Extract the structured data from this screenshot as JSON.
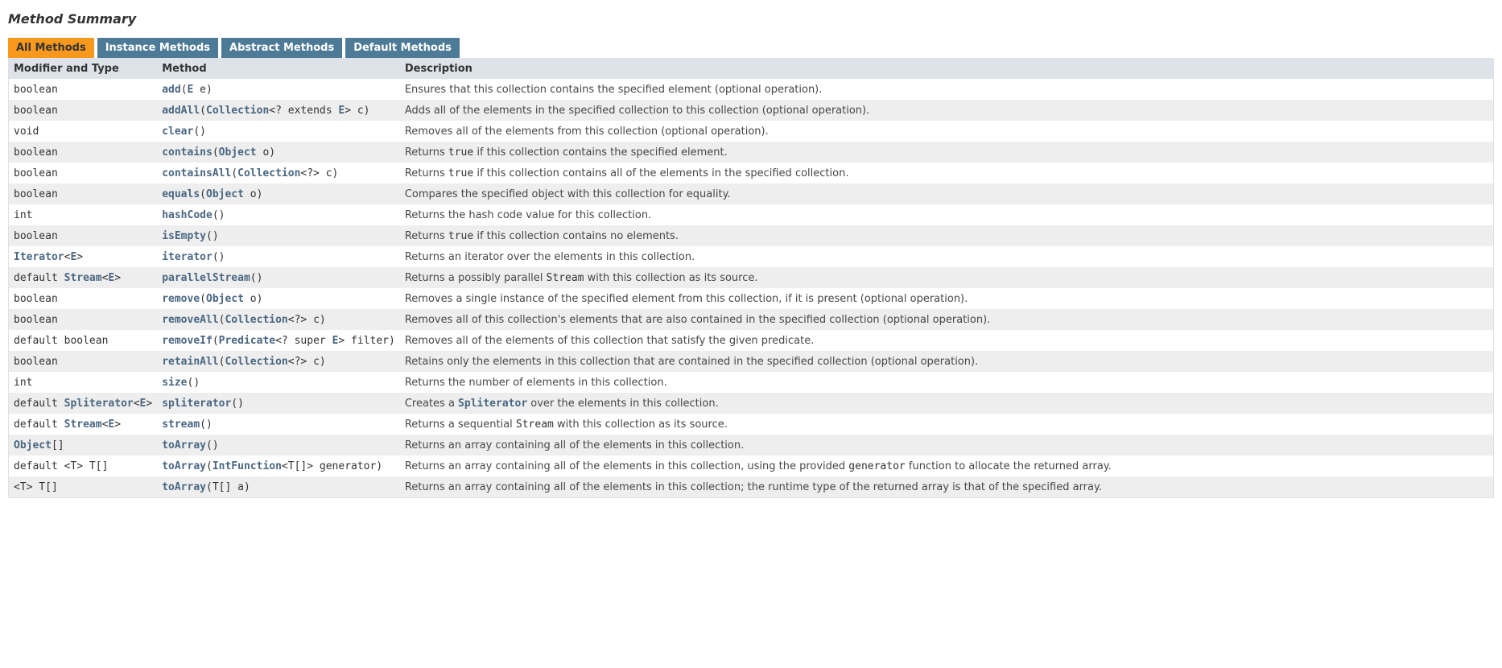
{
  "section_title": "Method Summary",
  "tabs": [
    {
      "label": "All Methods",
      "active": true
    },
    {
      "label": "Instance Methods",
      "active": false
    },
    {
      "label": "Abstract Methods",
      "active": false
    },
    {
      "label": "Default Methods",
      "active": false
    }
  ],
  "columns": {
    "modifier": "Modifier and Type",
    "method": "Method",
    "description": "Description"
  },
  "rows": [
    {
      "modifier": [
        {
          "t": "boolean"
        }
      ],
      "method": [
        {
          "l": "add"
        },
        {
          "t": "("
        },
        {
          "l": "E"
        },
        {
          "t": " e)"
        }
      ],
      "description": [
        {
          "t": "Ensures that this collection contains the specified element (optional operation)."
        }
      ]
    },
    {
      "modifier": [
        {
          "t": "boolean"
        }
      ],
      "method": [
        {
          "l": "addAll"
        },
        {
          "t": "("
        },
        {
          "l": "Collection"
        },
        {
          "t": "<? extends "
        },
        {
          "l": "E"
        },
        {
          "t": "> c)"
        }
      ],
      "description": [
        {
          "t": "Adds all of the elements in the specified collection to this collection (optional operation)."
        }
      ]
    },
    {
      "modifier": [
        {
          "t": "void"
        }
      ],
      "method": [
        {
          "l": "clear"
        },
        {
          "t": "()"
        }
      ],
      "description": [
        {
          "t": "Removes all of the elements from this collection (optional operation)."
        }
      ]
    },
    {
      "modifier": [
        {
          "t": "boolean"
        }
      ],
      "method": [
        {
          "l": "contains"
        },
        {
          "t": "("
        },
        {
          "l": "Object"
        },
        {
          "t": " o)"
        }
      ],
      "description": [
        {
          "t": "Returns "
        },
        {
          "c": "true"
        },
        {
          "t": " if this collection contains the specified element."
        }
      ]
    },
    {
      "modifier": [
        {
          "t": "boolean"
        }
      ],
      "method": [
        {
          "l": "containsAll"
        },
        {
          "t": "("
        },
        {
          "l": "Collection"
        },
        {
          "t": "<?> c)"
        }
      ],
      "description": [
        {
          "t": "Returns "
        },
        {
          "c": "true"
        },
        {
          "t": " if this collection contains all of the elements in the specified collection."
        }
      ]
    },
    {
      "modifier": [
        {
          "t": "boolean"
        }
      ],
      "method": [
        {
          "l": "equals"
        },
        {
          "t": "("
        },
        {
          "l": "Object"
        },
        {
          "t": " o)"
        }
      ],
      "description": [
        {
          "t": "Compares the specified object with this collection for equality."
        }
      ]
    },
    {
      "modifier": [
        {
          "t": "int"
        }
      ],
      "method": [
        {
          "l": "hashCode"
        },
        {
          "t": "()"
        }
      ],
      "description": [
        {
          "t": "Returns the hash code value for this collection."
        }
      ]
    },
    {
      "modifier": [
        {
          "t": "boolean"
        }
      ],
      "method": [
        {
          "l": "isEmpty"
        },
        {
          "t": "()"
        }
      ],
      "description": [
        {
          "t": "Returns "
        },
        {
          "c": "true"
        },
        {
          "t": " if this collection contains no elements."
        }
      ]
    },
    {
      "modifier": [
        {
          "l": "Iterator"
        },
        {
          "t": "<"
        },
        {
          "l": "E"
        },
        {
          "t": ">"
        }
      ],
      "method": [
        {
          "l": "iterator"
        },
        {
          "t": "()"
        }
      ],
      "description": [
        {
          "t": "Returns an iterator over the elements in this collection."
        }
      ]
    },
    {
      "modifier": [
        {
          "t": "default "
        },
        {
          "l": "Stream"
        },
        {
          "t": "<"
        },
        {
          "l": "E"
        },
        {
          "t": ">"
        }
      ],
      "method": [
        {
          "l": "parallelStream"
        },
        {
          "t": "()"
        }
      ],
      "description": [
        {
          "t": "Returns a possibly parallel "
        },
        {
          "c": "Stream"
        },
        {
          "t": " with this collection as its source."
        }
      ]
    },
    {
      "modifier": [
        {
          "t": "boolean"
        }
      ],
      "method": [
        {
          "l": "remove"
        },
        {
          "t": "("
        },
        {
          "l": "Object"
        },
        {
          "t": " o)"
        }
      ],
      "description": [
        {
          "t": "Removes a single instance of the specified element from this collection, if it is present (optional operation)."
        }
      ]
    },
    {
      "modifier": [
        {
          "t": "boolean"
        }
      ],
      "method": [
        {
          "l": "removeAll"
        },
        {
          "t": "("
        },
        {
          "l": "Collection"
        },
        {
          "t": "<?> c)"
        }
      ],
      "description": [
        {
          "t": "Removes all of this collection's elements that are also contained in the specified collection (optional operation)."
        }
      ]
    },
    {
      "modifier": [
        {
          "t": "default boolean"
        }
      ],
      "method": [
        {
          "l": "removeIf"
        },
        {
          "t": "("
        },
        {
          "l": "Predicate"
        },
        {
          "t": "<? super "
        },
        {
          "l": "E"
        },
        {
          "t": "> filter)"
        }
      ],
      "description": [
        {
          "t": "Removes all of the elements of this collection that satisfy the given predicate."
        }
      ]
    },
    {
      "modifier": [
        {
          "t": "boolean"
        }
      ],
      "method": [
        {
          "l": "retainAll"
        },
        {
          "t": "("
        },
        {
          "l": "Collection"
        },
        {
          "t": "<?> c)"
        }
      ],
      "description": [
        {
          "t": "Retains only the elements in this collection that are contained in the specified collection (optional operation)."
        }
      ]
    },
    {
      "modifier": [
        {
          "t": "int"
        }
      ],
      "method": [
        {
          "l": "size"
        },
        {
          "t": "()"
        }
      ],
      "description": [
        {
          "t": "Returns the number of elements in this collection."
        }
      ]
    },
    {
      "modifier": [
        {
          "t": "default "
        },
        {
          "l": "Spliterator"
        },
        {
          "t": "<"
        },
        {
          "l": "E"
        },
        {
          "t": ">"
        }
      ],
      "method": [
        {
          "l": "spliterator"
        },
        {
          "t": "()"
        }
      ],
      "description": [
        {
          "t": "Creates a "
        },
        {
          "l": "Spliterator"
        },
        {
          "t": " over the elements in this collection."
        }
      ]
    },
    {
      "modifier": [
        {
          "t": "default "
        },
        {
          "l": "Stream"
        },
        {
          "t": "<"
        },
        {
          "l": "E"
        },
        {
          "t": ">"
        }
      ],
      "method": [
        {
          "l": "stream"
        },
        {
          "t": "()"
        }
      ],
      "description": [
        {
          "t": "Returns a sequential "
        },
        {
          "c": "Stream"
        },
        {
          "t": " with this collection as its source."
        }
      ]
    },
    {
      "modifier": [
        {
          "l": "Object"
        },
        {
          "t": "[]"
        }
      ],
      "method": [
        {
          "l": "toArray"
        },
        {
          "t": "()"
        }
      ],
      "description": [
        {
          "t": "Returns an array containing all of the elements in this collection."
        }
      ]
    },
    {
      "modifier": [
        {
          "t": "default <T> T[]"
        }
      ],
      "method": [
        {
          "l": "toArray"
        },
        {
          "t": "("
        },
        {
          "l": "IntFunction"
        },
        {
          "t": "<T[]> generator)"
        }
      ],
      "description": [
        {
          "t": "Returns an array containing all of the elements in this collection, using the provided "
        },
        {
          "c": "generator"
        },
        {
          "t": " function to allocate the returned array."
        }
      ]
    },
    {
      "modifier": [
        {
          "t": "<T> T[]"
        }
      ],
      "method": [
        {
          "l": "toArray"
        },
        {
          "t": "(T[] a)"
        }
      ],
      "description": [
        {
          "t": "Returns an array containing all of the elements in this collection; the runtime type of the returned array is that of the specified array."
        }
      ]
    }
  ]
}
